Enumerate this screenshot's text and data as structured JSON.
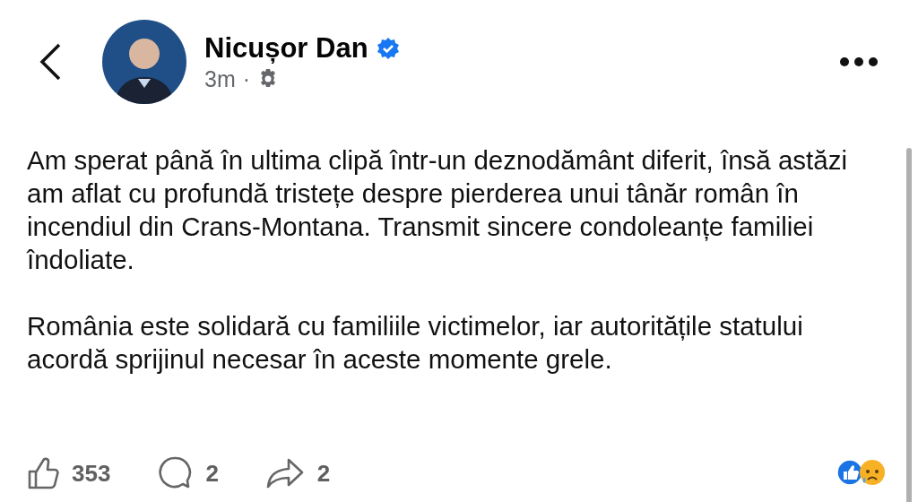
{
  "author": {
    "name": "Nicușor Dan",
    "verified": true,
    "time": "3m",
    "separator": "·"
  },
  "paragraphs": [
    "Am sperat până în ultima clipă într-un deznodământ diferit, însă astăzi am aflat cu profundă tristețe despre pierderea unui tânăr român în incendiul din Crans-Montana. Transmit sincere condoleanțe familiei îndoliate.",
    "România este solidară cu familiile victimelor, iar autoritățile statului acordă sprijinul necesar în aceste momente grele."
  ],
  "actions": [
    {
      "kind": "like",
      "count": "353"
    },
    {
      "kind": "comment",
      "count": "2"
    },
    {
      "kind": "share",
      "count": "2"
    }
  ],
  "reactions": [
    {
      "kind": "like"
    },
    {
      "kind": "sad"
    }
  ]
}
